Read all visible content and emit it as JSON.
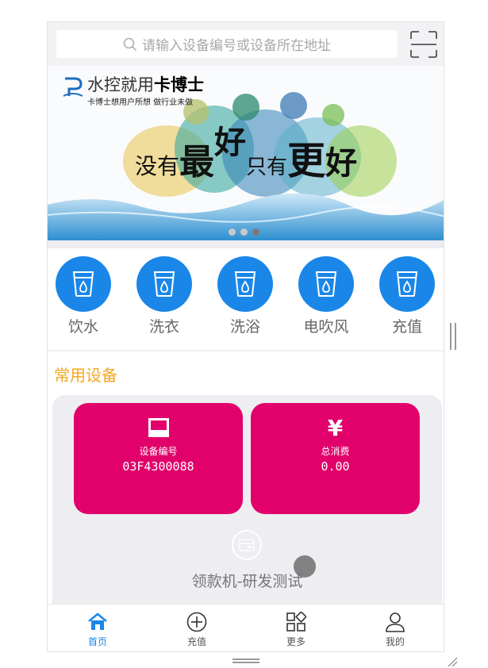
{
  "search": {
    "placeholder": "请输入设备编号或设备所在地址"
  },
  "banner": {
    "brand_title_plain": "水控就用",
    "brand_title_bold": "卡博士",
    "brand_sub": "卡博士想用户所想 做行业未做",
    "slogan": "没有最好只有更好",
    "dots": 3,
    "active_dot": 2
  },
  "quick_menu": [
    {
      "label": "饮水",
      "icon": "water-cup-icon"
    },
    {
      "label": "洗衣",
      "icon": "water-cup-icon"
    },
    {
      "label": "洗浴",
      "icon": "water-cup-icon"
    },
    {
      "label": "电吹风",
      "icon": "water-cup-icon"
    },
    {
      "label": "充值",
      "icon": "water-cup-icon"
    }
  ],
  "common": {
    "title": "常用设备",
    "device_no_label": "设备编号",
    "device_no": "03F4300088",
    "total_label": "总消费",
    "total": "0.00",
    "device_name": "领款机-研发测试"
  },
  "tabs": [
    {
      "label": "首页",
      "icon": "home-icon",
      "active": true
    },
    {
      "label": "充值",
      "icon": "plus-circle-icon",
      "active": false
    },
    {
      "label": "更多",
      "icon": "grid-icon",
      "active": false
    },
    {
      "label": "我的",
      "icon": "user-icon",
      "active": false
    }
  ],
  "colors": {
    "accent": "#1a87e8",
    "card": "#e2006b",
    "title": "#f5a623"
  }
}
